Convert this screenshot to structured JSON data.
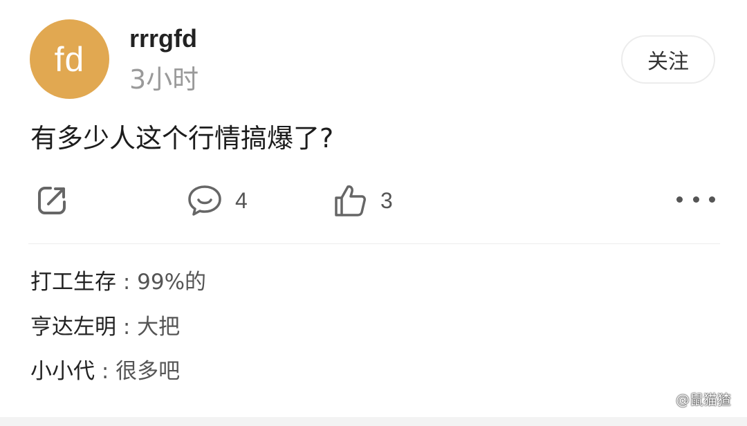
{
  "post": {
    "avatar_text": "fd",
    "username": "rrrgfd",
    "time": "3小时",
    "follow_label": "关注",
    "content": "有多少人这个行情搞爆了?",
    "avatar_color": "#e1a851"
  },
  "actions": {
    "share_icon": "share-icon",
    "comment_icon": "comment-icon",
    "comment_count": "4",
    "like_icon": "thumbs-up-icon",
    "like_count": "3",
    "more_icon": "more-icon"
  },
  "comments": [
    {
      "user": "打工生存",
      "sep": " : ",
      "text": "99%的"
    },
    {
      "user": "亨达左明",
      "sep": " : ",
      "text": "大把"
    },
    {
      "user": "小小代",
      "sep": " : ",
      "text": "很多吧"
    }
  ],
  "watermark": {
    "icon": "platform-logo-icon",
    "text": "@鼠猫猹"
  }
}
